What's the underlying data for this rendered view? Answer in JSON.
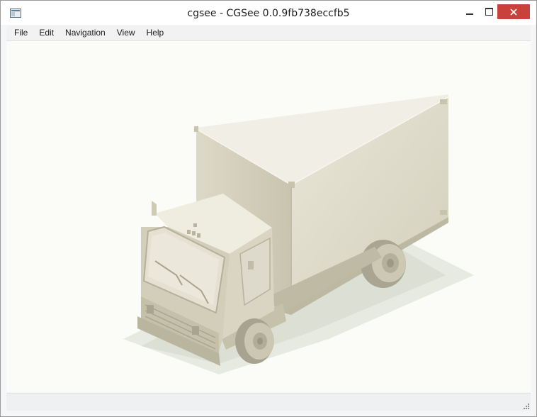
{
  "window": {
    "title": "cgsee - CGSee 0.0.9fb738eccfb5",
    "app_icon": "window-app-icon",
    "controls": [
      "minimize-icon",
      "maximize-icon",
      "close-icon"
    ]
  },
  "menubar": {
    "items": [
      {
        "label": "File"
      },
      {
        "label": "Edit"
      },
      {
        "label": "Navigation"
      },
      {
        "label": "View"
      },
      {
        "label": "Help"
      }
    ]
  },
  "viewport": {
    "content": "truck-3d-model"
  },
  "colors": {
    "close_button": "#c9413b",
    "viewport_background": "#fbfcf8",
    "model": "#d8d4c2"
  }
}
